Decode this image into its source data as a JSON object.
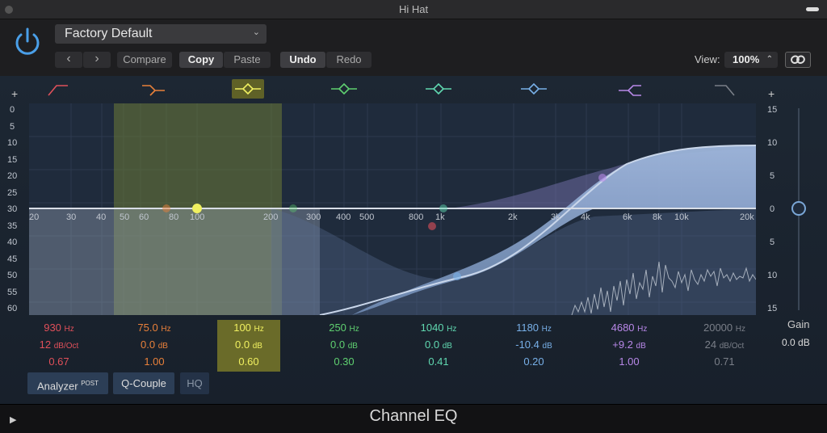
{
  "window": {
    "title": "Hi Hat"
  },
  "header": {
    "preset": "Factory Default",
    "prev": "‹",
    "next": "›",
    "compare": "Compare",
    "copy": "Copy",
    "paste": "Paste",
    "undo": "Undo",
    "redo": "Redo",
    "view_label": "View:",
    "view_value": "100%"
  },
  "graph": {
    "freq_labels": [
      "20",
      "30",
      "40",
      "50",
      "60",
      "80",
      "100",
      "200",
      "300",
      "400",
      "500",
      "800",
      "1k",
      "2k",
      "3k",
      "4k",
      "6k",
      "8k",
      "10k",
      "20k"
    ],
    "left_scale": [
      "0",
      "5",
      "10",
      "15",
      "20",
      "25",
      "30",
      "35",
      "40",
      "45",
      "50",
      "55",
      "60"
    ],
    "right_scale": [
      "15",
      "10",
      "5",
      "0",
      "5",
      "10",
      "15"
    ],
    "plus_left": "+",
    "plus_right": "+"
  },
  "bands": [
    {
      "freq": "930",
      "freq_unit": "Hz",
      "gain": "12",
      "gain_unit": "dB/Oct",
      "q": "0.67",
      "color": "#e0505a"
    },
    {
      "freq": "75.0",
      "freq_unit": "Hz",
      "gain": "0.0",
      "gain_unit": "dB",
      "q": "1.00",
      "color": "#e8803a"
    },
    {
      "freq": "100",
      "freq_unit": "Hz",
      "gain": "0.0",
      "gain_unit": "dB",
      "q": "0.60",
      "color": "#f0f060"
    },
    {
      "freq": "250",
      "freq_unit": "Hz",
      "gain": "0.0",
      "gain_unit": "dB",
      "q": "0.30",
      "color": "#5fd070"
    },
    {
      "freq": "1040",
      "freq_unit": "Hz",
      "gain": "0.0",
      "gain_unit": "dB",
      "q": "0.41",
      "color": "#60d8b0"
    },
    {
      "freq": "1180",
      "freq_unit": "Hz",
      "gain": "-10.4",
      "gain_unit": "dB",
      "q": "0.20",
      "color": "#78b0e8"
    },
    {
      "freq": "4680",
      "freq_unit": "Hz",
      "gain": "+9.2",
      "gain_unit": "dB",
      "q": "1.00",
      "color": "#b888e8"
    },
    {
      "freq": "20000",
      "freq_unit": "Hz",
      "gain": "24",
      "gain_unit": "dB/Oct",
      "q": "0.71",
      "color": "#7a7f88"
    }
  ],
  "gain": {
    "label": "Gain",
    "value": "0.0 dB"
  },
  "toolbar": {
    "analyzer": "Analyzer",
    "analyzer_sup": "POST",
    "qcouple": "Q-Couple",
    "hq": "HQ"
  },
  "footer": {
    "plugin_name": "Channel EQ"
  }
}
